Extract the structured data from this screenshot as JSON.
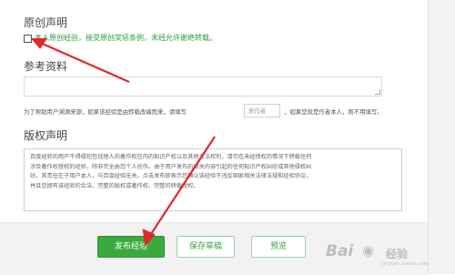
{
  "sections": {
    "original": {
      "title": "原创声明",
      "checkbox_label": "本人原创经验，接受原创奖惩条例，未经允许谢绝转载。"
    },
    "references": {
      "title": "参考资料",
      "hint_before": "为了帮助用户溯源来源，如果该经验是由转载改编而来，请填写",
      "author_placeholder": "原作者",
      "hint_after": "，如果您就是作者本人，则不用填写。"
    },
    "copyright": {
      "title": "版权声明",
      "lines": [
        "百度经验的用户不得侵犯包括他人的著作权在内的知识产权以及其他合法权利，请勿在未经授权的情况下转载任何",
        "涉及著作权授权的经验，除非完全由您个人创作。由于用户发布的相关内容引起的任何知识产权纠纷或其他侵权纠",
        "纷，其责任在于用户本人，与百度经验无关。点击发布即表示您确认该经验不违反国家相关法律法规和经验协议，",
        "并且您拥有该经验的合法、完整的版权或著作权、完整的转载授权。"
      ]
    }
  },
  "buttons": {
    "publish": "发布经验",
    "save_draft": "保存草稿",
    "preview": "预览"
  },
  "watermark": {
    "brand_left": "Bai",
    "brand_right": "经验",
    "url": "jingyan.baidu.com"
  },
  "colors": {
    "accent_green": "#3aaa3e",
    "annotation_red": "#e3262a"
  }
}
